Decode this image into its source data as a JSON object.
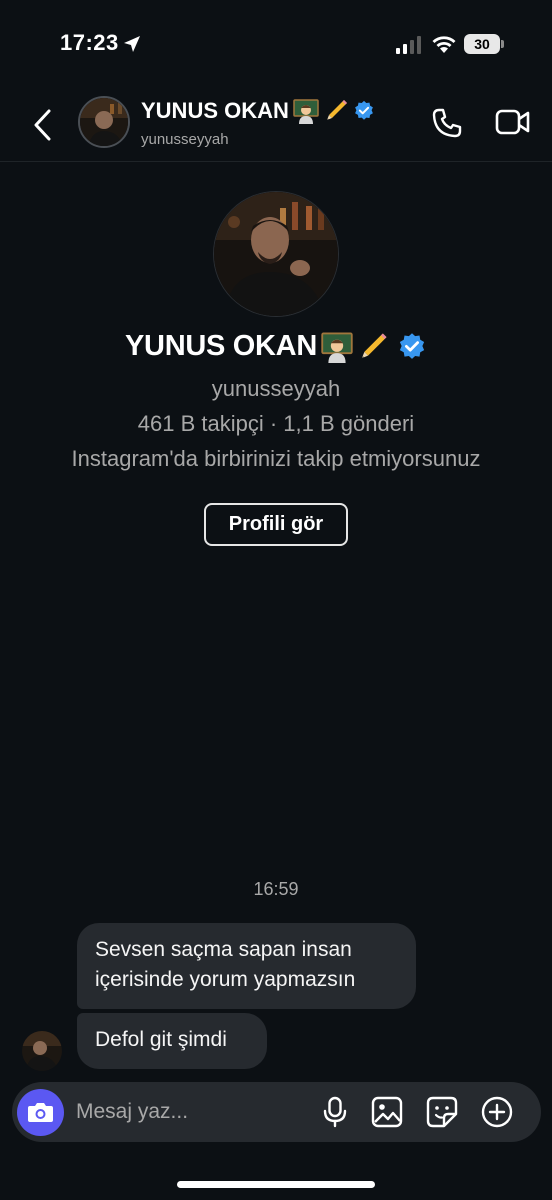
{
  "status_bar": {
    "time": "17:23",
    "battery": "30"
  },
  "header": {
    "name": "YUNUS OKAN",
    "username": "yunusseyyah"
  },
  "profile": {
    "name": "YUNUS OKAN",
    "username": "yunusseyyah",
    "stats": "461 B takipçi · 1,1 B gönderi",
    "follow_note": "Instagram'da birbirinizi takip etmiyorsunuz",
    "view_profile_label": "Profili gör"
  },
  "chat": {
    "timestamp": "16:59",
    "messages": [
      {
        "text": "Sevsen saçma sapan insan içerisinde yorum yapmazsın"
      },
      {
        "text": "Defol git şimdi"
      }
    ]
  },
  "composer": {
    "placeholder": "Mesaj yaz..."
  },
  "icons": {
    "back": "chevron-left-icon",
    "call": "phone-icon",
    "video": "video-camera-icon",
    "camera": "camera-icon",
    "mic": "microphone-icon",
    "gallery": "image-icon",
    "sticker": "sticker-icon",
    "plus": "plus-circle-icon",
    "verified": "verified-badge-icon"
  },
  "colors": {
    "background": "#0c1014",
    "bubble": "#262a2f",
    "accent": "#5b58f2",
    "verified": "#3897f0"
  }
}
